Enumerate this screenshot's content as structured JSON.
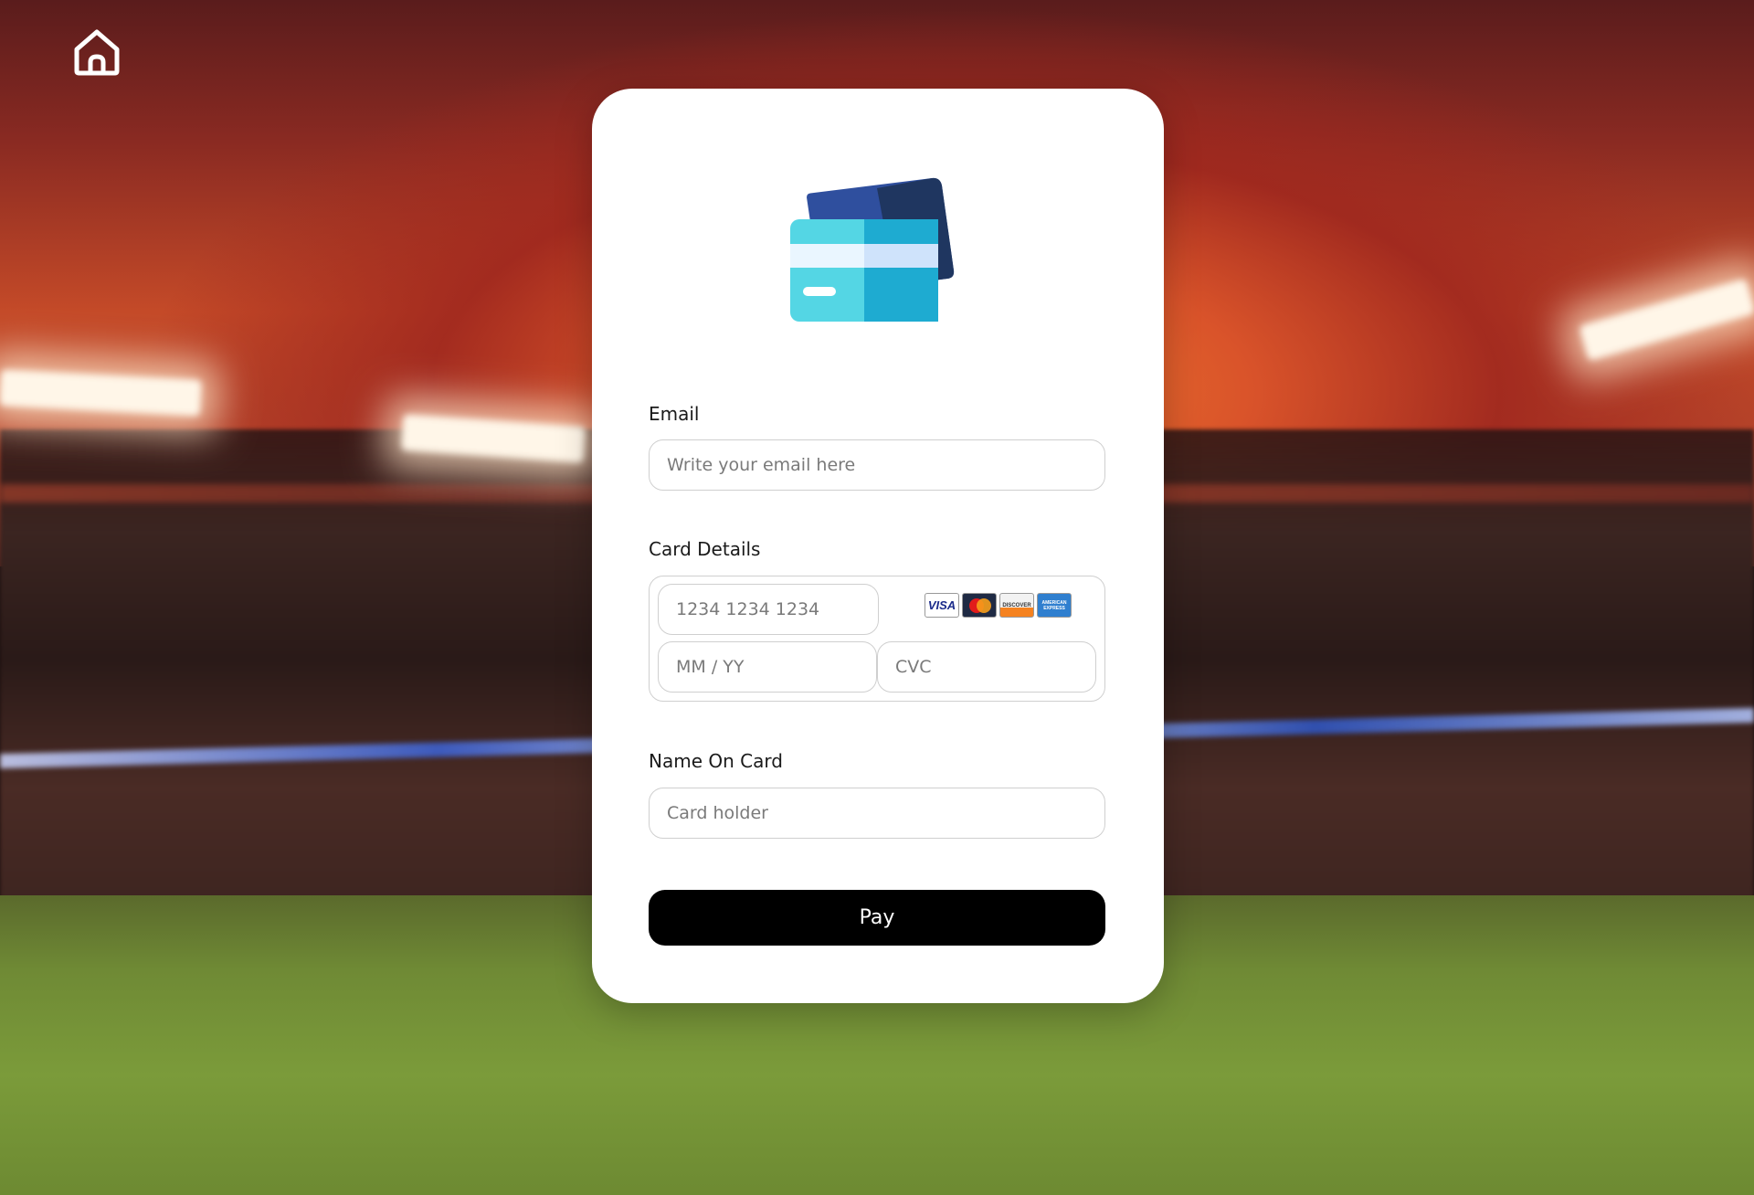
{
  "nav": {
    "home_icon": "home-icon"
  },
  "hero": {
    "icon": "credit-cards-icon"
  },
  "form": {
    "email": {
      "label": "Email",
      "placeholder": "Write your email here",
      "value": ""
    },
    "card_details": {
      "label": "Card Details",
      "number_placeholder": "1234 1234 1234",
      "expiry_placeholder": "MM / YY",
      "cvc_placeholder": "CVC",
      "brands": [
        {
          "name": "visa",
          "text": "VISA"
        },
        {
          "name": "mastercard",
          "text": ""
        },
        {
          "name": "discover",
          "text": "DISCOVER"
        },
        {
          "name": "american-express",
          "text": "AMERICAN EXPRESS"
        }
      ]
    },
    "name_on_card": {
      "label": "Name On Card",
      "placeholder": "Card holder",
      "value": ""
    },
    "submit_label": "Pay"
  },
  "colors": {
    "button_bg": "#000000",
    "card_bg": "#ffffff",
    "card_front": "#4fd3e3",
    "card_back": "#1f3a63"
  }
}
